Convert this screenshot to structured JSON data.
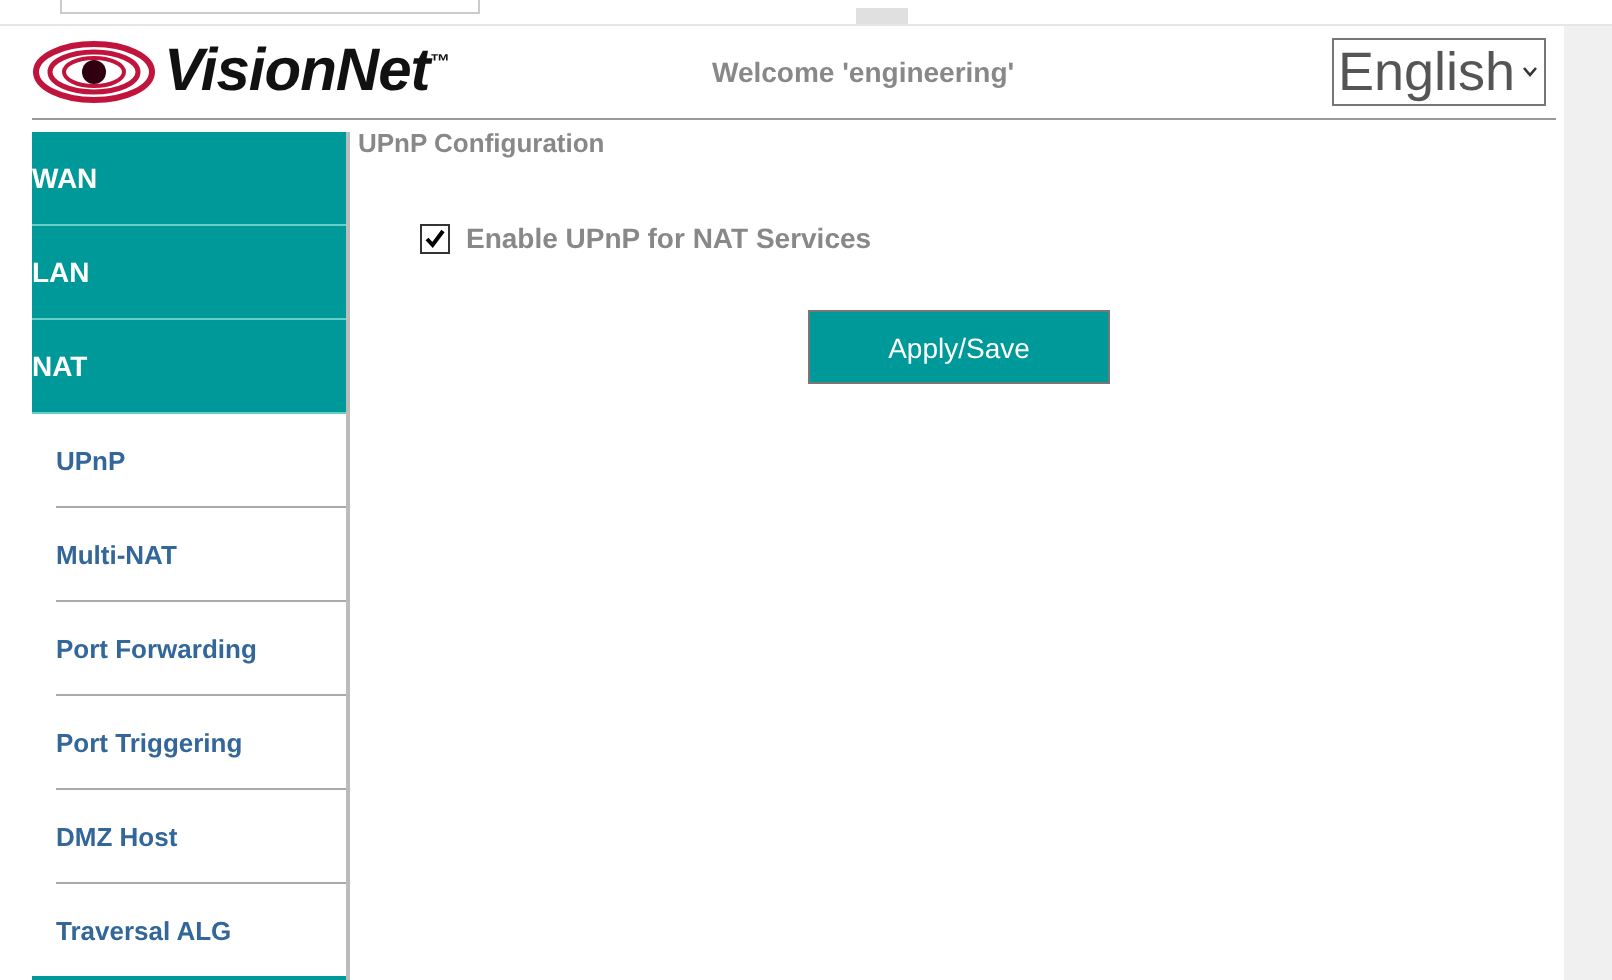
{
  "header": {
    "logo_text": "VisionNet$^{™}$",
    "welcome": "Welcome 'engineering'",
    "language": "English"
  },
  "sidebar": {
    "items": [
      {
        "label": "WAN",
        "kind": "group"
      },
      {
        "label": "LAN",
        "kind": "group"
      },
      {
        "label": "NAT",
        "kind": "group"
      },
      {
        "label": "UPnP",
        "kind": "sub"
      },
      {
        "label": "Multi-NAT",
        "kind": "sub"
      },
      {
        "label": "Port Forwarding",
        "kind": "sub"
      },
      {
        "label": "Port Triggering",
        "kind": "sub"
      },
      {
        "label": "DMZ Host",
        "kind": "sub"
      },
      {
        "label": "Traversal ALG",
        "kind": "sub"
      }
    ]
  },
  "content": {
    "title": "UPnP Configuration",
    "checkbox": {
      "label": "Enable UPnP for NAT Services",
      "checked": true
    },
    "button": "Apply/Save"
  }
}
